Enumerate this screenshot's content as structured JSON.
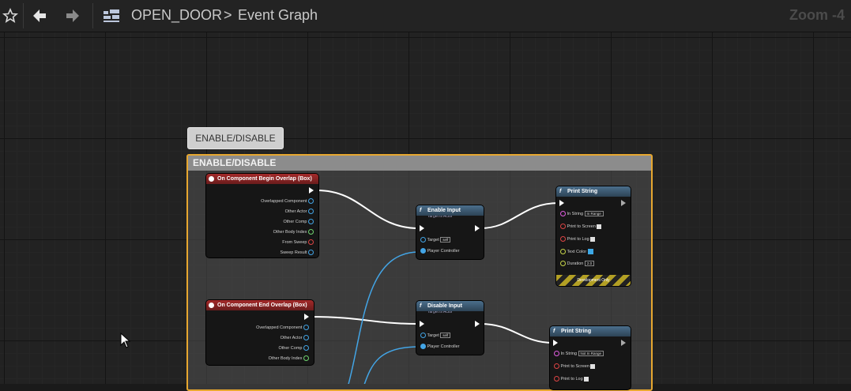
{
  "toolbar": {
    "star_icon": "star-icon",
    "back_icon": "arrow-left-icon",
    "forward_icon": "arrow-right-icon",
    "graph_icon": "blueprint-grid-icon",
    "breadcrumb_root": "OPEN_DOOR",
    "breadcrumb_sep": ">",
    "breadcrumb_current": "Event Graph",
    "zoom": "Zoom -4"
  },
  "comment": {
    "bubble_label": "ENABLE/DISABLE",
    "box_title": "ENABLE/DISABLE",
    "border_color": "#e7a72f"
  },
  "nodes": {
    "begin_overlap": {
      "title": "On Component Begin Overlap (Box)",
      "pins": [
        "Overlapped Component",
        "Other Actor",
        "Other Comp",
        "Other Body Index",
        "From Sweep",
        "Sweep Result"
      ]
    },
    "end_overlap": {
      "title": "On Component End Overlap (Box)",
      "pins": [
        "Overlapped Component",
        "Other Actor",
        "Other Comp",
        "Other Body Index"
      ]
    },
    "enable_input": {
      "title": "Enable Input",
      "subtitle": "Target is Actor",
      "target_label": "Target",
      "target_value": "self",
      "pc_label": "Player Controller"
    },
    "disable_input": {
      "title": "Disable Input",
      "subtitle": "Target is Actor",
      "target_label": "Target",
      "target_value": "self",
      "pc_label": "Player Controller"
    },
    "print_1": {
      "title": "Print String",
      "in_string_label": "In String",
      "in_string_value": "In Range",
      "print_screen": "Print to Screen",
      "print_log": "Print to Log",
      "text_color": "Text Color",
      "duration": "Duration",
      "duration_value": "2.0",
      "dev_only": "Development Only"
    },
    "print_2": {
      "title": "Print String",
      "in_string_label": "In String",
      "in_string_value": "Not In Range",
      "print_screen": "Print to Screen",
      "print_log": "Print to Log"
    }
  },
  "colors": {
    "exec_wire": "#ffffff",
    "object_wire": "#43a5e6",
    "event_header": "#a42a2a",
    "function_header": "#4b6f8c"
  }
}
